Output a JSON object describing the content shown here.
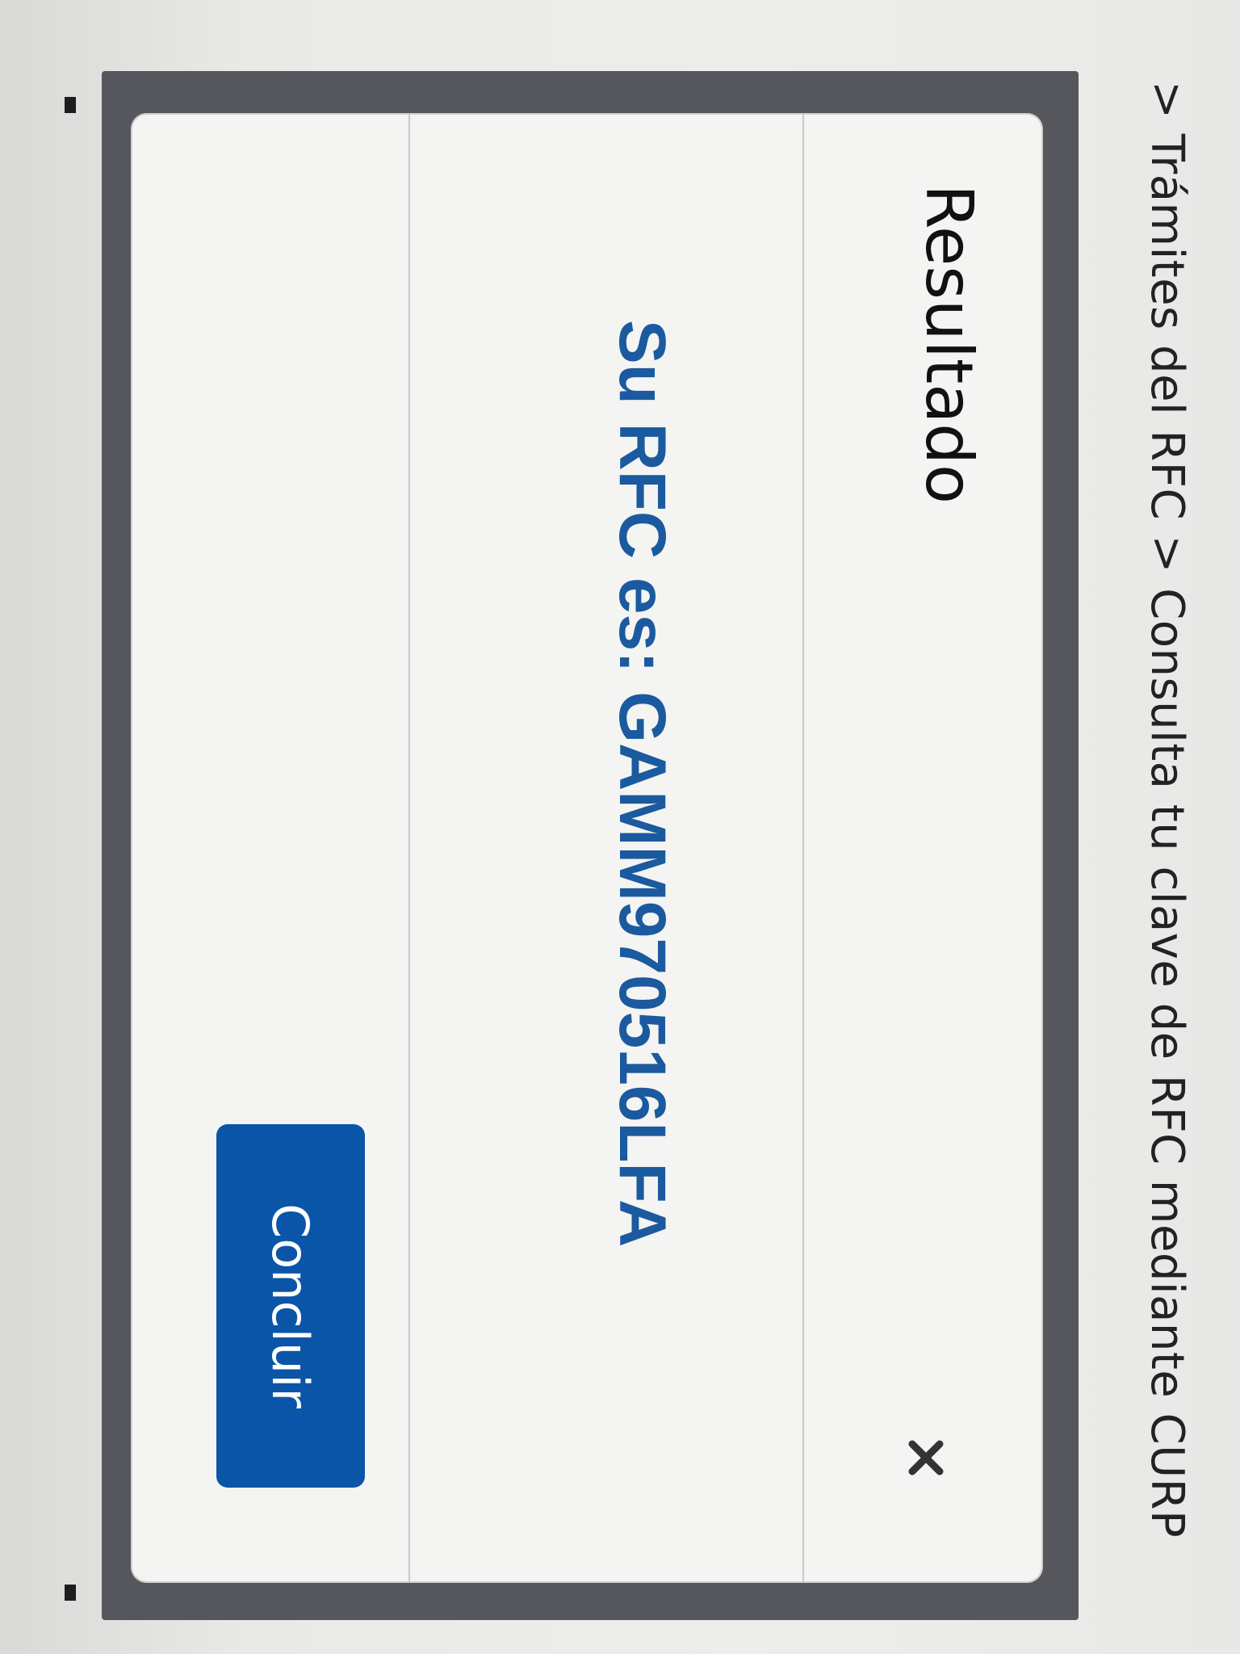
{
  "breadcrumb": {
    "text": "> Trámites del RFC > Consulta tu clave de RFC mediante CURP"
  },
  "modal": {
    "title": "Resultado",
    "close_icon": "close-icon",
    "message": "Su RFC es: GAMM970516LFA",
    "primary_button_label": "Concluir"
  },
  "colors": {
    "accent_button": "#0b55a8",
    "result_text": "#1b5a9e",
    "overlay": "#55575c"
  }
}
